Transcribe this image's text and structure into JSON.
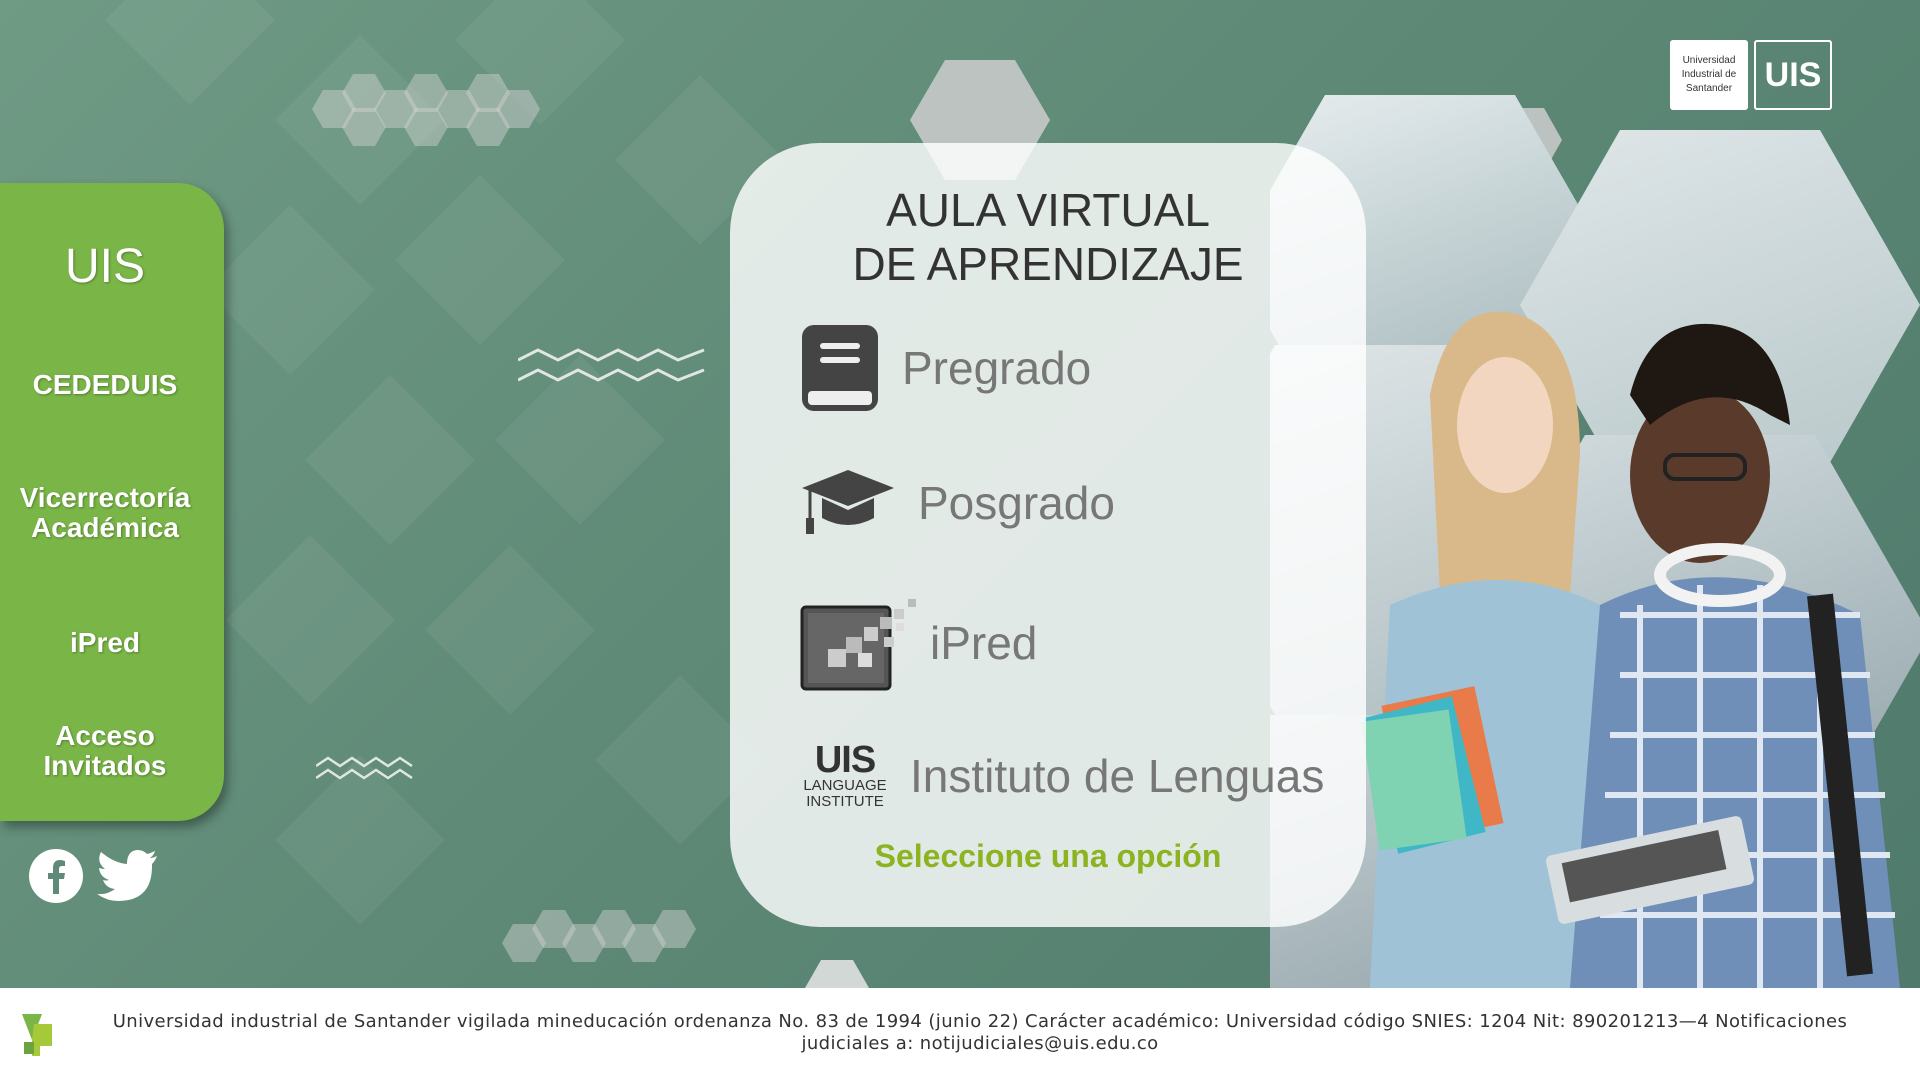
{
  "sidebar": {
    "items": [
      {
        "label": "UIS"
      },
      {
        "label": "CEDEDUIS"
      },
      {
        "label_line1": "Vicerrectoría",
        "label_line2": "Académica"
      },
      {
        "label": "iPred"
      },
      {
        "label_line1": "Acceso",
        "label_line2": "Invitados"
      }
    ]
  },
  "card": {
    "title_line1": "AULA VIRTUAL",
    "title_line2": "DE APRENDIZAJE",
    "options": [
      {
        "label": "Pregrado",
        "icon": "book-icon"
      },
      {
        "label": "Posgrado",
        "icon": "graduation-cap-icon"
      },
      {
        "label": "iPred",
        "icon": "ipred-logo-icon"
      },
      {
        "label": "Instituto de Lenguas",
        "icon": "uis-language-institute-logo"
      }
    ],
    "language_logo_line1": "UIS",
    "language_logo_line2": "LANGUAGE",
    "language_logo_line3": "INSTITUTE",
    "hint": "Seleccione una opción"
  },
  "logo": {
    "text_line1": "Universidad",
    "text_line2": "Industrial de",
    "text_line3": "Santander",
    "mark": "UIS"
  },
  "social": [
    {
      "name": "facebook-icon"
    },
    {
      "name": "twitter-icon"
    }
  ],
  "footer": {
    "text": "Universidad industrial de Santander vigilada mineducación ordenanza No. 83 de 1994 (junio 22) Carácter académico: Universidad código SNIES: 1204 Nit: 890201213—4 Notificaciones judiciales a: notijudiciales@uis.edu.co"
  },
  "colors": {
    "sidebar_green": "#7ab547",
    "hint_green": "#8cb320",
    "background": "#5f8a77"
  }
}
